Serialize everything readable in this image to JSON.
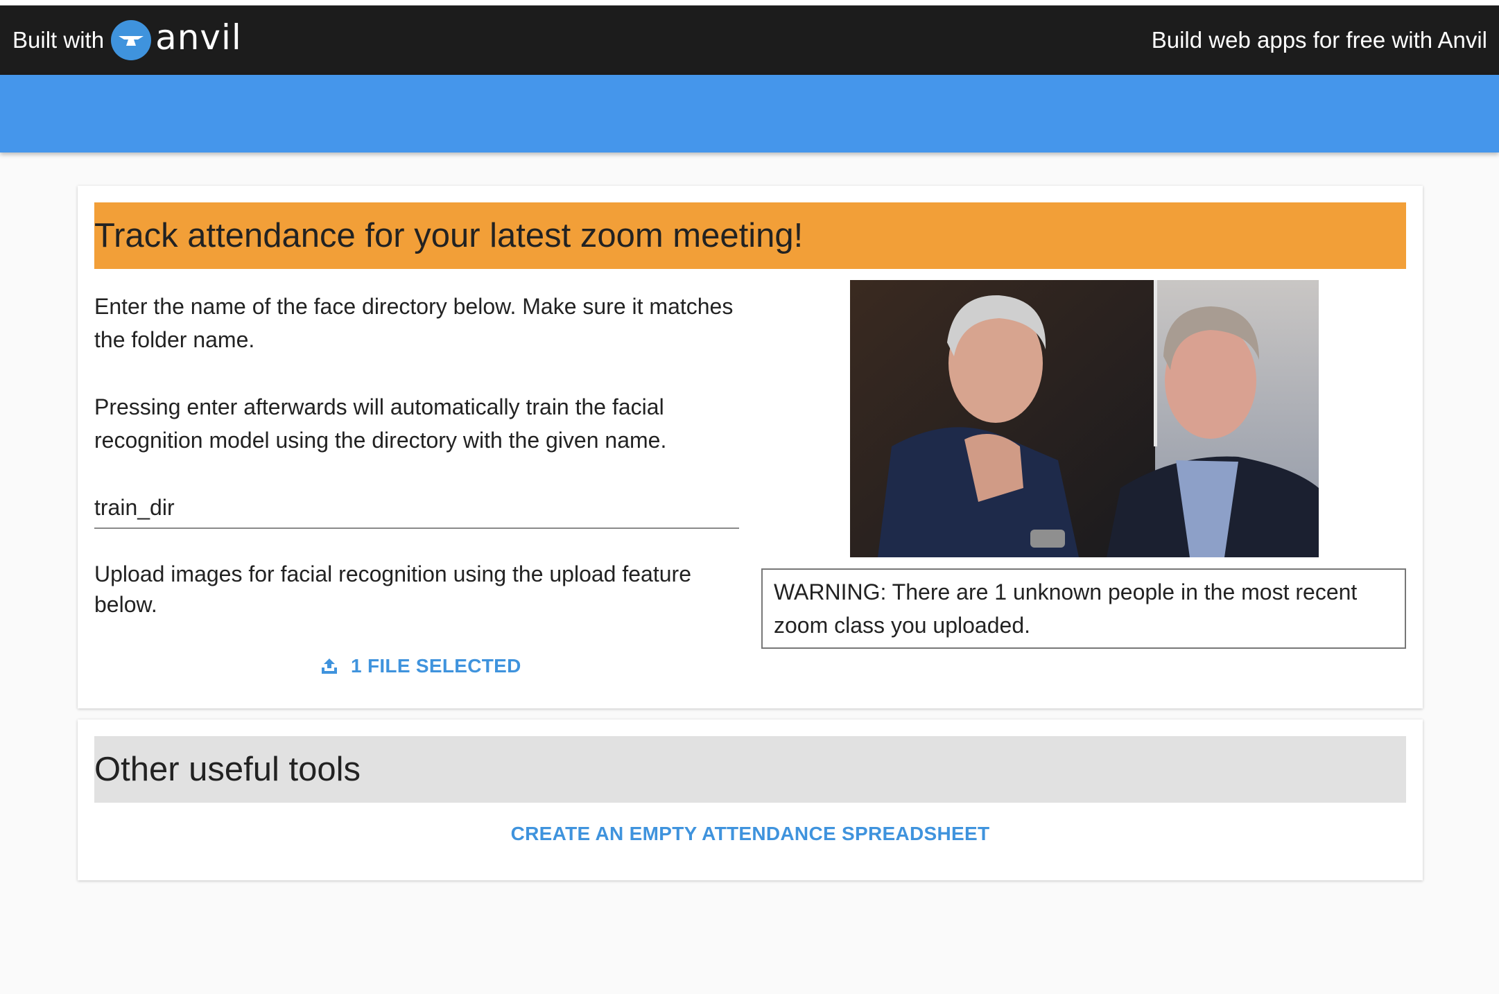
{
  "anvil_banner": {
    "built_with": "Built with",
    "logo_word": "anvil",
    "promo_link": "Build web apps for free with Anvil"
  },
  "attendance_card": {
    "title": "Track attendance for your latest zoom meeting!",
    "instructions_directory": "Enter the name of the face directory below. Make sure it matches the folder name.",
    "instructions_train": "Pressing enter afterwards will automatically train the facial recognition model using the directory with the given name.",
    "directory_input_value": "train_dir",
    "instructions_upload": "Upload images for facial recognition using the upload feature below.",
    "upload_button_label": "1 FILE SELECTED",
    "warning_text": "WARNING: There are 1 unknown people in the most recent zoom class you uploaded."
  },
  "tools_card": {
    "title": "Other useful tools",
    "spreadsheet_button_label": "CREATE AN EMPTY ATTENDANCE SPREADSHEET"
  },
  "colors": {
    "anvil_bar": "#1c1c1c",
    "app_bar": "#4596eb",
    "orange_header": "#f29f38",
    "grey_header": "#e1e1e1",
    "link_blue": "#3f93dd"
  },
  "icons": {
    "logo": "anvil-logo-icon",
    "upload": "upload-icon"
  }
}
